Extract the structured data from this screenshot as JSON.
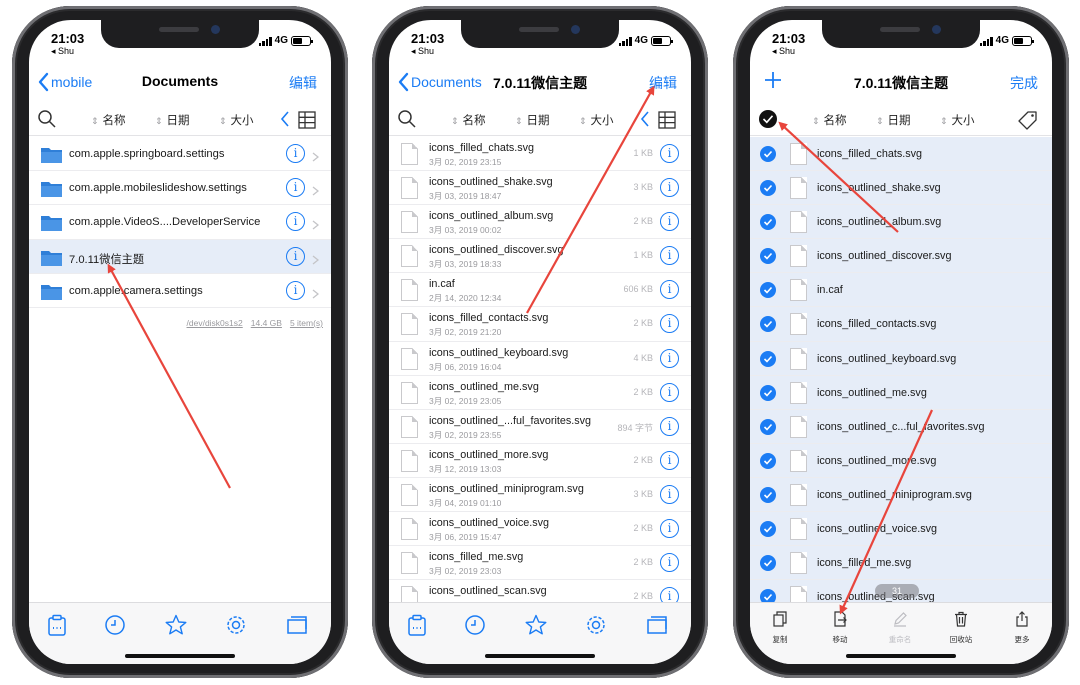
{
  "status": {
    "time": "21:03",
    "back_app": "◂ Shu",
    "network": "4G"
  },
  "screen1": {
    "nav": {
      "back": "mobile",
      "title": "Documents",
      "action": "编辑"
    },
    "sort": {
      "name": "名称",
      "date": "日期",
      "size": "大小"
    },
    "folders": [
      "com.apple.springboard.settings",
      "com.apple.mobileslideshow.settings",
      "com.apple.VideoS....DeveloperService",
      "7.0.11微信主题",
      "com.apple.camera.settings"
    ],
    "footer": {
      "disk": "/dev/disk0s1s2",
      "free": "14.4 GB",
      "count": "5 item(s)"
    }
  },
  "screen2": {
    "nav": {
      "back": "Documents",
      "title": "7.0.11微信主题",
      "action": "编辑"
    },
    "sort": {
      "name": "名称",
      "date": "日期",
      "size": "大小"
    },
    "files": [
      {
        "name": "icons_filled_chats.svg",
        "date": "3月 02, 2019 23:15",
        "size": "1 KB"
      },
      {
        "name": "icons_outlined_shake.svg",
        "date": "3月 03, 2019 18:47",
        "size": "3 KB"
      },
      {
        "name": "icons_outlined_album.svg",
        "date": "3月 03, 2019 00:02",
        "size": "2 KB"
      },
      {
        "name": "icons_outlined_discover.svg",
        "date": "3月 03, 2019 18:33",
        "size": "1 KB"
      },
      {
        "name": "in.caf",
        "date": "2月 14, 2020 12:34",
        "size": "606 KB"
      },
      {
        "name": "icons_filled_contacts.svg",
        "date": "3月 02, 2019 21:20",
        "size": "2 KB"
      },
      {
        "name": "icons_outlined_keyboard.svg",
        "date": "3月 06, 2019 16:04",
        "size": "4 KB"
      },
      {
        "name": "icons_outlined_me.svg",
        "date": "3月 02, 2019 23:05",
        "size": "2 KB"
      },
      {
        "name": "icons_outlined_...ful_favorites.svg",
        "date": "3月 02, 2019 23:55",
        "size": "894 字节"
      },
      {
        "name": "icons_outlined_more.svg",
        "date": "3月 12, 2019 13:03",
        "size": "2 KB"
      },
      {
        "name": "icons_outlined_miniprogram.svg",
        "date": "3月 04, 2019 01:10",
        "size": "3 KB"
      },
      {
        "name": "icons_outlined_voice.svg",
        "date": "3月 06, 2019 15:47",
        "size": "2 KB"
      },
      {
        "name": "icons_filled_me.svg",
        "date": "3月 02, 2019 23:03",
        "size": "2 KB"
      },
      {
        "name": "icons_outlined_scan.svg",
        "date": "",
        "size": "2 KB"
      }
    ]
  },
  "screen3": {
    "nav": {
      "title": "7.0.11微信主题",
      "action": "完成"
    },
    "sort": {
      "name": "名称",
      "date": "日期",
      "size": "大小"
    },
    "files": [
      "icons_filled_chats.svg",
      "icons_outlined_shake.svg",
      "icons_outlined_album.svg",
      "icons_outlined_discover.svg",
      "in.caf",
      "icons_filled_contacts.svg",
      "icons_outlined_keyboard.svg",
      "icons_outlined_me.svg",
      "icons_outlined_c...ful_favorites.svg",
      "icons_outlined_more.svg",
      "icons_outlined_miniprogram.svg",
      "icons_outlined_voice.svg",
      "icons_filled_me.svg",
      "icons_outlined_scan.svg"
    ],
    "count_badge": "31",
    "toolbar": {
      "copy": "复制",
      "move": "移动",
      "rename": "重命名",
      "trash": "回收站",
      "more": "更多"
    }
  },
  "colors": {
    "accent": "#1b7cf4",
    "selection": "#e6edf8",
    "arrow": "#e8453c"
  },
  "icons": [
    "search-icon",
    "sort-arrows-icon",
    "grid-view-icon",
    "folder-icon",
    "info-icon",
    "chevron-right-icon",
    "document-icon",
    "checkmark-icon",
    "tag-icon",
    "clipboard-icon",
    "clock-icon",
    "star-icon",
    "gear-icon",
    "windows-icon",
    "plus-icon"
  ]
}
